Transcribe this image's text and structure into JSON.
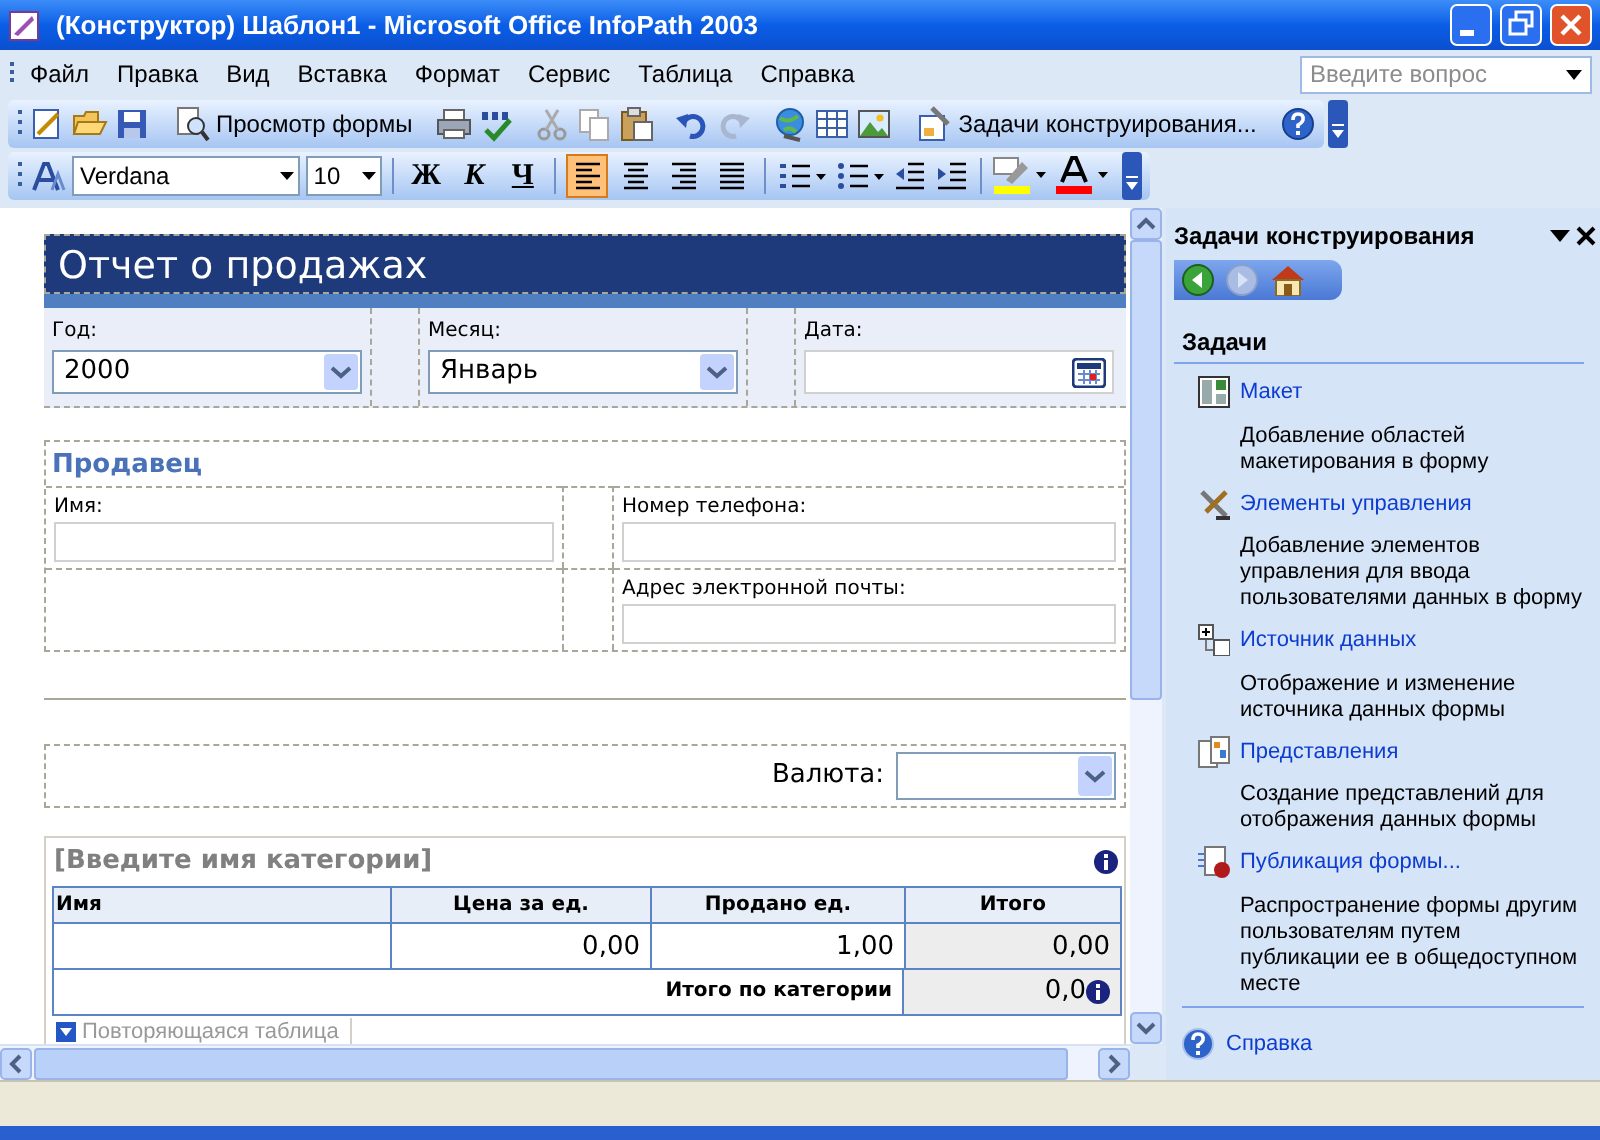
{
  "window": {
    "title": "(Конструктор) Шаблон1 - Microsoft Office InfoPath 2003"
  },
  "menu": {
    "items": [
      "Файл",
      "Правка",
      "Вид",
      "Вставка",
      "Формат",
      "Сервис",
      "Таблица",
      "Справка"
    ],
    "help_search": {
      "placeholder": "Введите вопрос"
    }
  },
  "standard_toolbar": {
    "preview_label": "Просмотр формы",
    "design_tasks_label": "Задачи конструирования..."
  },
  "format_toolbar": {
    "font": "Verdana",
    "size": "10",
    "bold": "Ж",
    "italic": "К",
    "underline": "Ч",
    "alignment": [
      {
        "kind": "left",
        "selected": true
      },
      {
        "kind": "center",
        "selected": false
      },
      {
        "kind": "right",
        "selected": false
      },
      {
        "kind": "justify",
        "selected": false
      }
    ]
  },
  "form": {
    "title": "Отчет о продажах",
    "header_fields": [
      {
        "label": "Год:",
        "value": "2000",
        "kind": "dropdown"
      },
      {
        "label": "Месяц:",
        "value": "Январь",
        "kind": "dropdown"
      },
      {
        "label": "Дата:",
        "kind": "date"
      }
    ],
    "seller": {
      "heading": "Продавец",
      "fields": [
        {
          "label": "Имя:"
        },
        {
          "label": "Номер телефона:"
        },
        {
          "label": "Адрес электронной почты:"
        }
      ]
    },
    "currency": {
      "label": "Валюта:"
    },
    "category": {
      "title": "[Введите имя категории]",
      "table": {
        "columns": [
          "Имя",
          "Цена за ед.",
          "Продано ед.",
          "Итого"
        ],
        "rows": [
          {
            "price": "0,00",
            "sold": "1,00",
            "total": "0,00"
          }
        ],
        "footer": {
          "label": "Итого по категории",
          "value": "0,0"
        }
      },
      "repeating_tag": "Повторяющаяся таблица"
    }
  },
  "task_pane": {
    "title": "Задачи конструирования",
    "section": "Задачи",
    "tasks": [
      {
        "kind": "layout",
        "label": "Макет",
        "description": "Добавление областей макетирования в форму"
      },
      {
        "kind": "controls",
        "label": "Элементы управления",
        "description": "Добавление элементов управления для ввода пользователями данных в форму"
      },
      {
        "kind": "datasource",
        "label": "Источник данных",
        "description": "Отображение и изменение источника данных формы"
      },
      {
        "kind": "views",
        "label": "Представления",
        "description": "Создание представлений для отображения данных формы"
      },
      {
        "kind": "publish",
        "label": "Публикация формы...",
        "description": "Распространение формы другим пользователям путем публикации ее в общедоступном месте"
      }
    ],
    "help_link": "Справка"
  }
}
